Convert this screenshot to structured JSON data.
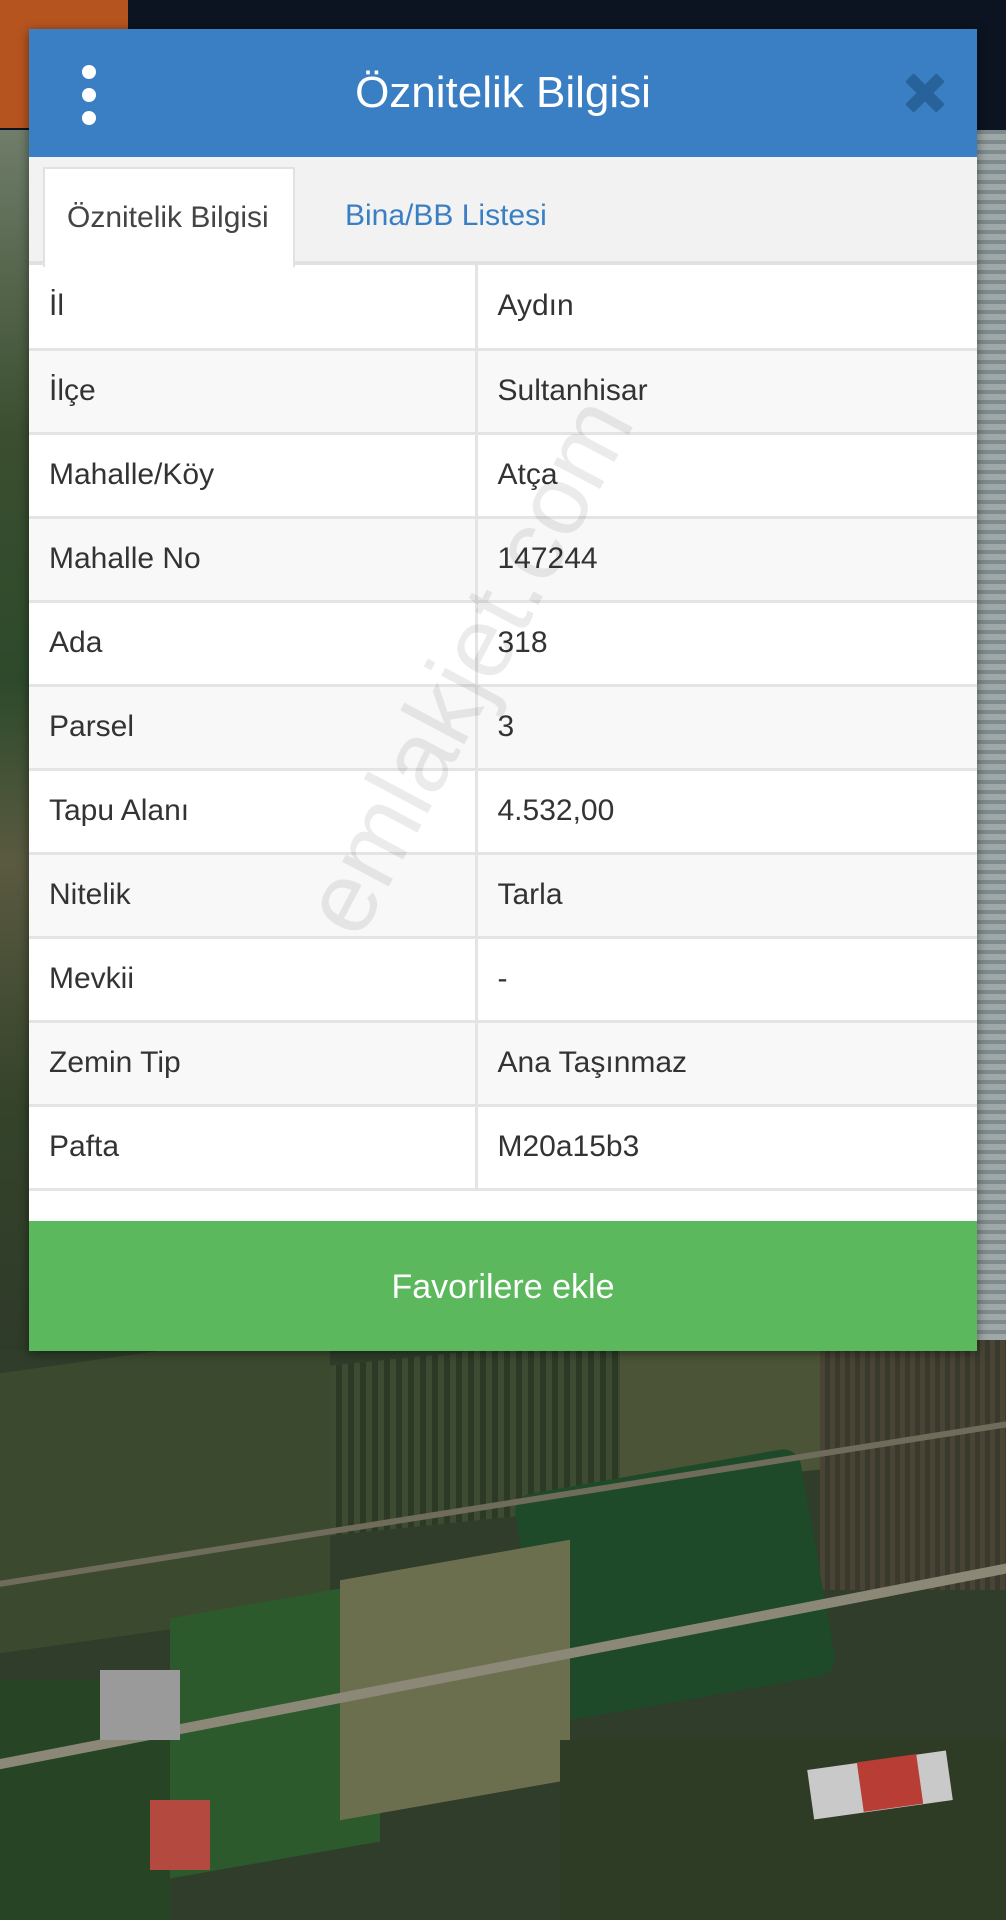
{
  "dialog": {
    "title": "Öznitelik Bilgisi",
    "menu_icon": "vertical-dots-icon",
    "close_icon": "close-icon"
  },
  "tabs": [
    {
      "label": "Öznitelik Bilgisi",
      "active": true
    },
    {
      "label": "Bina/BB Listesi",
      "active": false
    }
  ],
  "attributes": [
    {
      "key": "İl",
      "value": "Aydın"
    },
    {
      "key": "İlçe",
      "value": "Sultanhisar"
    },
    {
      "key": "Mahalle/Köy",
      "value": "Atça"
    },
    {
      "key": "Mahalle No",
      "value": "147244"
    },
    {
      "key": "Ada",
      "value": "318"
    },
    {
      "key": "Parsel",
      "value": "3"
    },
    {
      "key": "Tapu Alanı",
      "value": "4.532,00"
    },
    {
      "key": "Nitelik",
      "value": "Tarla"
    },
    {
      "key": "Mevkii",
      "value": "-"
    },
    {
      "key": "Zemin Tip",
      "value": "Ana Taşınmaz"
    },
    {
      "key": "Pafta",
      "value": "M20a15b3"
    }
  ],
  "favorite_button": {
    "label": "Favorilere ekle"
  },
  "watermark": "emlakjet.com",
  "colors": {
    "header": "#3a7fc3",
    "tab_link": "#3a7fc3",
    "favorite_button": "#5cb85c"
  }
}
